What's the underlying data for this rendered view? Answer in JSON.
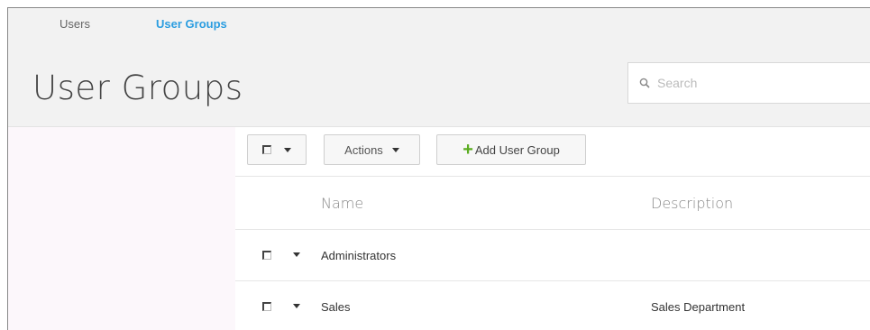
{
  "tabs": [
    {
      "label": "Users",
      "active": false
    },
    {
      "label": "User Groups",
      "active": true
    }
  ],
  "page": {
    "title": "User Groups"
  },
  "search": {
    "placeholder": "Search",
    "value": ""
  },
  "toolbar": {
    "actions_label": "Actions",
    "add_label": "Add User Group"
  },
  "table": {
    "columns": [
      "Name",
      "Description"
    ],
    "rows": [
      {
        "name": "Administrators",
        "description": ""
      },
      {
        "name": "Sales",
        "description": "Sales Department"
      }
    ]
  },
  "colors": {
    "active_tab": "#2b9de0",
    "add_icon": "#5aac1f",
    "header_bg": "#f2f2f2",
    "sidebar_bg": "#fcf7fb"
  },
  "icons": [
    "search-icon",
    "checkbox-icon",
    "chevron-down-icon",
    "plus-icon"
  ]
}
